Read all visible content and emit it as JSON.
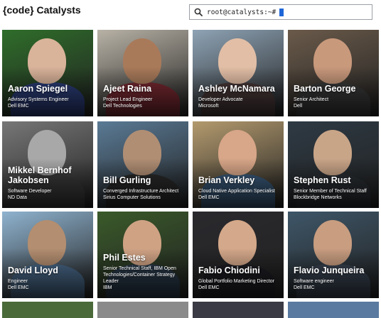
{
  "header": {
    "title": "{code} Catalysts",
    "search_icon": "search-icon",
    "prompt": "root@catalysts:~#"
  },
  "cards": [
    {
      "name": "Aaron Spiegel",
      "role": "Advisory Systems Engineer",
      "company": "Dell EMC",
      "bg": "#2f6d2a",
      "skin": "#d9b39a",
      "shirt": "#2c3e7a"
    },
    {
      "name": "Ajeet Raina",
      "role": "Project Lead Engineer",
      "company": "Dell Technologies",
      "bg": "#b8b2a6",
      "skin": "#a97a5a",
      "shirt": "#7a2a32"
    },
    {
      "name": "Ashley McNamara",
      "role": "Developer Advocate",
      "company": "Microsoft",
      "bg": "#8ea3b5",
      "skin": "#e2bea6",
      "shirt": "#4a3a3a"
    },
    {
      "name": "Barton George",
      "role": "Senior Architect",
      "company": "Dell",
      "bg": "#6a5a4a",
      "skin": "#c9997c",
      "shirt": "#3a3a3a"
    },
    {
      "name": "Mikkel Bernhof Jakobsen",
      "role": "Software Developer",
      "company": "ND Data",
      "bg": "#777777",
      "skin": "#a8a8a8",
      "shirt": "#3a3a3a"
    },
    {
      "name": "Bill Gurling",
      "role": "Converged Infrastructure Architect",
      "company": "Sirius Computer Solutions",
      "bg": "#5a7a95",
      "skin": "#b08e74",
      "shirt": "#2a2a2a"
    },
    {
      "name": "Brian Verkley",
      "role": "Cloud Native Application Specialist",
      "company": "Dell EMC",
      "bg": "#b39a6e",
      "skin": "#d8a688",
      "shirt": "#3a5a7a"
    },
    {
      "name": "Stephen Rust",
      "role": "Senior Member of Technical Staff",
      "company": "Blockbridge Networks",
      "bg": "#2e3a44",
      "skin": "#c9a588",
      "shirt": "#2a2e33"
    },
    {
      "name": "David Lloyd",
      "role": "Engineer",
      "company": "Dell EMC",
      "bg": "#8fb3cf",
      "skin": "#b38e70",
      "shirt": "#4a6a8a"
    },
    {
      "name": "Phil Estes",
      "role": "Senior Technical Staff, IBM Open Technologies/Container Strategy Leader",
      "company": "IBM",
      "bg": "#3a5a2a",
      "skin": "#cfa284",
      "shirt": "#2a3a4a"
    },
    {
      "name": "Fabio Chiodini",
      "role": "Global Portfolio Marketing Director",
      "company": "Dell EMC",
      "bg": "#2a2a2e",
      "skin": "#d4a88a",
      "shirt": "#1e1e24"
    },
    {
      "name": "Flavio Junqueira",
      "role": "Software engineer",
      "company": "Dell EMC",
      "bg": "#3e5668",
      "skin": "#c89d80",
      "shirt": "#3a4452"
    }
  ]
}
